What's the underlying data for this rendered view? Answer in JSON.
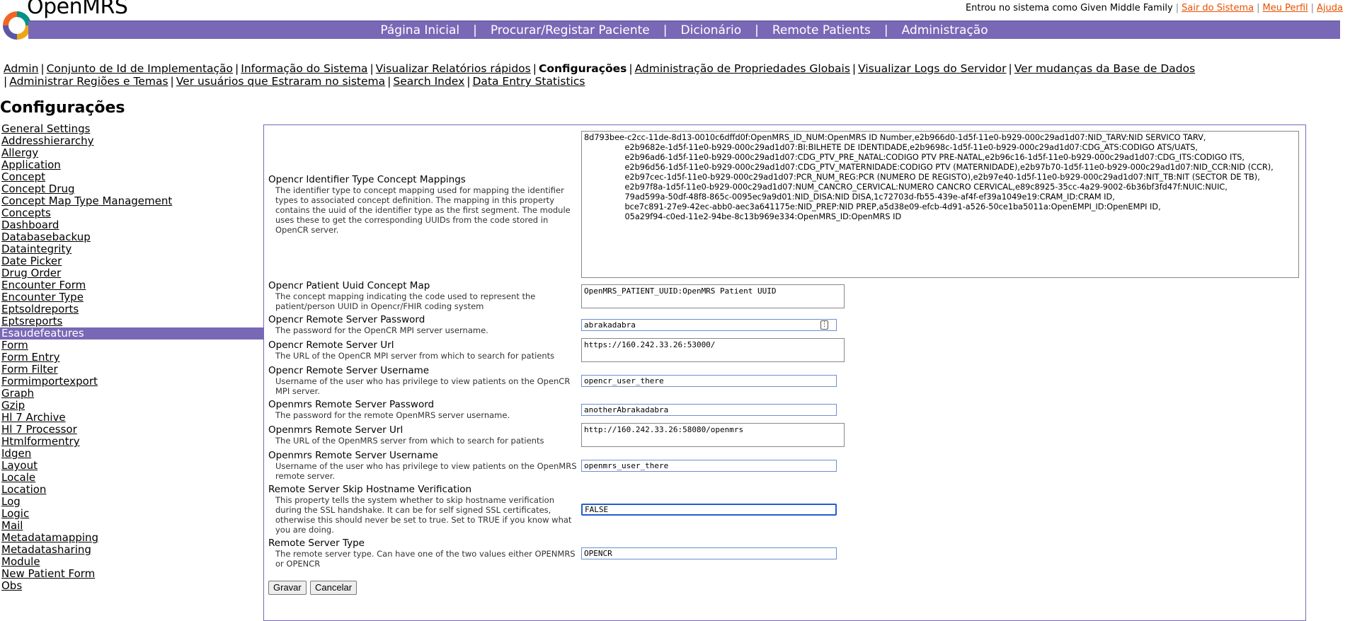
{
  "header": {
    "brand": "OpenMRS",
    "user_text": "Entrou no sistema como Given Middle Family",
    "logout": "Sair do Sistema",
    "profile": "Meu Perfil",
    "help": "Ajuda"
  },
  "nav": [
    "Página Inicial",
    "Procurar/Registar Paciente",
    "Dicionário",
    "Remote Patients",
    "Administração"
  ],
  "admin_links": [
    "Admin",
    "Conjunto de Id de Implementação",
    "Informação do Sistema",
    "Visualizar Relatórios rápidos",
    "Configurações",
    "Administração de Propriedades Globais",
    "Visualizar Logs do Servidor",
    "Ver mudanças da Base de Dados",
    "Administrar Regiões e Temas",
    "Ver usuários que Estraram no sistema",
    "Search Index",
    "Data Entry Statistics"
  ],
  "page_title": "Configurações",
  "sidebar": [
    "General Settings",
    "Addresshierarchy",
    "Allergy",
    "Application",
    "Concept",
    "Concept Drug",
    "Concept Map Type Management",
    "Concepts",
    "Dashboard",
    "Databasebackup",
    "Dataintegrity",
    "Date Picker",
    "Drug Order",
    "Encounter Form",
    "Encounter Type",
    "Eptsoldreports",
    "Eptsreports",
    "Esaudefeatures",
    "Form",
    "Form Entry",
    "Form Filter",
    "Formimportexport",
    "Graph",
    "Gzip",
    "Hl 7 Archive",
    "Hl 7 Processor",
    "Htmlformentry",
    "Idgen",
    "Layout",
    "Locale",
    "Location",
    "Log",
    "Logic",
    "Mail",
    "Metadatamapping",
    "Metadatasharing",
    "Module",
    "New Patient Form",
    "Obs"
  ],
  "selected_sidebar": "Esaudefeatures",
  "properties": [
    {
      "name": "Opencr Identifier Type Concept Mappings",
      "desc": "The identifier type to concept mapping used for mapping the identifier types to associated concept definition. The mapping in this property contains the uuid of the identifier type as the first segment. The module uses these to get the corresponding UUIDs from the code stored in OpenCR server.",
      "value": "8d793bee-c2cc-11de-8d13-0010c6dffd0f:OpenMRS_ID_NUM:OpenMRS ID Number,e2b966d0-1d5f-11e0-b929-000c29ad1d07:NID_TARV:NID SERVICO TARV,\n                e2b9682e-1d5f-11e0-b929-000c29ad1d07:BI:BILHETE DE IDENTIDADE,e2b9698c-1d5f-11e0-b929-000c29ad1d07:CDG_ATS:CODIGO ATS/UATS,\n                e2b96ad6-1d5f-11e0-b929-000c29ad1d07:CDG_PTV_PRE_NATAL:CODIGO PTV PRE-NATAL,e2b96c16-1d5f-11e0-b929-000c29ad1d07:CDG_ITS:CODIGO ITS,\n                e2b96d56-1d5f-11e0-b929-000c29ad1d07:CDG_PTV_MATERNIDADE:CODIGO PTV (MATERNIDADE),e2b97b70-1d5f-11e0-b929-000c29ad1d07:NID_CCR:NID (CCR),\n                e2b97cec-1d5f-11e0-b929-000c29ad1d07:PCR_NUM_REG:PCR (NUMERO DE REGISTO),e2b97e40-1d5f-11e0-b929-000c29ad1d07:NIT_TB:NIT (SECTOR DE TB),\n                e2b97f8a-1d5f-11e0-b929-000c29ad1d07:NUM_CANCRO_CERVICAL:NUMERO CANCRO CERVICAL,e89c8925-35cc-4a29-9002-6b36bf3fd47f:NUIC:NUIC,\n                79ad599a-50df-48f8-865c-0095ec9a9d01:NID_DISA:NID DISA,1c72703d-fb55-439e-af4f-ef39a1049e19:CRAM_ID:CRAM ID,\n                bce7c891-27e9-42ec-abb0-aec3a641175e:NID_PREP:NID PREP,a5d38e09-efcb-4d91-a526-50ce1ba5011a:OpenEMPI_ID:OpenEMPI ID,\n                05a29f94-c0ed-11e2-94be-8c13b969e334:OpenMRS_ID:OpenMRS ID"
    },
    {
      "name": "Opencr Patient Uuid Concept Map",
      "desc": "The concept mapping indicating the code used to represent the patient/person UUID in Opencr/FHIR coding system",
      "value": "OpenMRS_PATIENT_UUID:OpenMRS Patient UUID"
    },
    {
      "name": "Opencr Remote Server Password",
      "desc": "The password for the OpenCR MPI server username.",
      "value": "abrakadabra"
    },
    {
      "name": "Opencr Remote Server Url",
      "desc": "The URL of the OpenCR MPI server from which to search for patients",
      "value": "https://160.242.33.26:53000/"
    },
    {
      "name": "Opencr Remote Server Username",
      "desc": "Username of the user who has privilege to view patients on the OpenCR MPI server.",
      "value": "opencr_user_there"
    },
    {
      "name": "Openmrs Remote Server Password",
      "desc": "The password for the remote OpenMRS server username.",
      "value": "anotherAbrakadabra"
    },
    {
      "name": "Openmrs Remote Server Url",
      "desc": "The URL of the OpenMRS server from which to search for patients",
      "value": "http://160.242.33.26:58080/openmrs"
    },
    {
      "name": "Openmrs Remote Server Username",
      "desc": "Username of the user who has privilege to view patients on the OpenMRS remote server.",
      "value": "openmrs_user_there"
    },
    {
      "name": "Remote Server Skip Hostname Verification",
      "desc": "This property tells the system whether to skip hostname verification during the SSL handshake. It can be for self signed SSL certificates, otherwise this should never be set to true. Set to TRUE if you know what you are doing.",
      "value": "FALSE"
    },
    {
      "name": "Remote Server Type",
      "desc": "The remote server type. Can have one of the two values either OPENMRS or OPENCR",
      "value": "OPENCR"
    }
  ],
  "buttons": {
    "save": "Gravar",
    "cancel": "Cancelar"
  },
  "colors": {
    "nav_bg": "#7968b6",
    "link_orange": "#e65100"
  }
}
